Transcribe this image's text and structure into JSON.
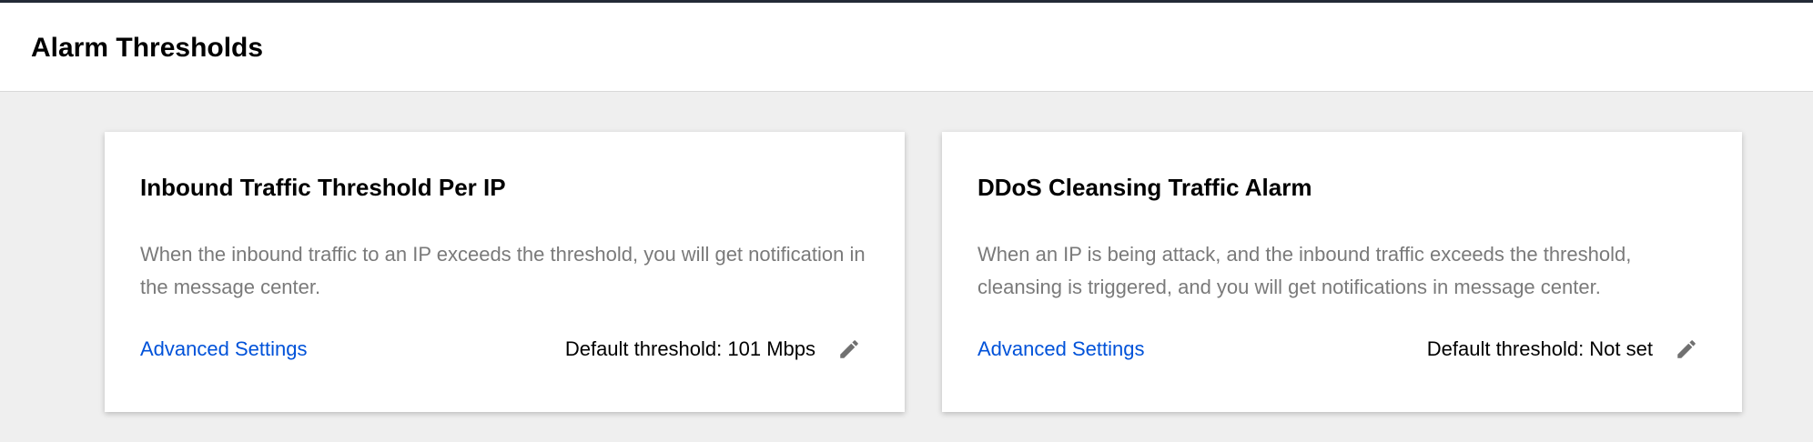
{
  "header": {
    "title": "Alarm Thresholds"
  },
  "cards": [
    {
      "title": "Inbound Traffic Threshold Per IP",
      "description": "When the inbound traffic to an IP exceeds the threshold, you will get notification in the message center.",
      "link_label": "Advanced Settings",
      "threshold_text": "Default threshold: 101 Mbps",
      "edit_icon": "pencil-icon"
    },
    {
      "title": "DDoS Cleansing Traffic Alarm",
      "description": "When an IP is being attack, and the inbound traffic exceeds the threshold, cleansing is triggered, and you will get notifications in message center.",
      "link_label": "Advanced Settings",
      "threshold_text": "Default threshold: Not set",
      "edit_icon": "pencil-icon"
    }
  ],
  "colors": {
    "link": "#0052d9",
    "description": "#7a7a7a",
    "background": "#efefef",
    "top_bar": "#232a36",
    "icon": "#707070"
  }
}
